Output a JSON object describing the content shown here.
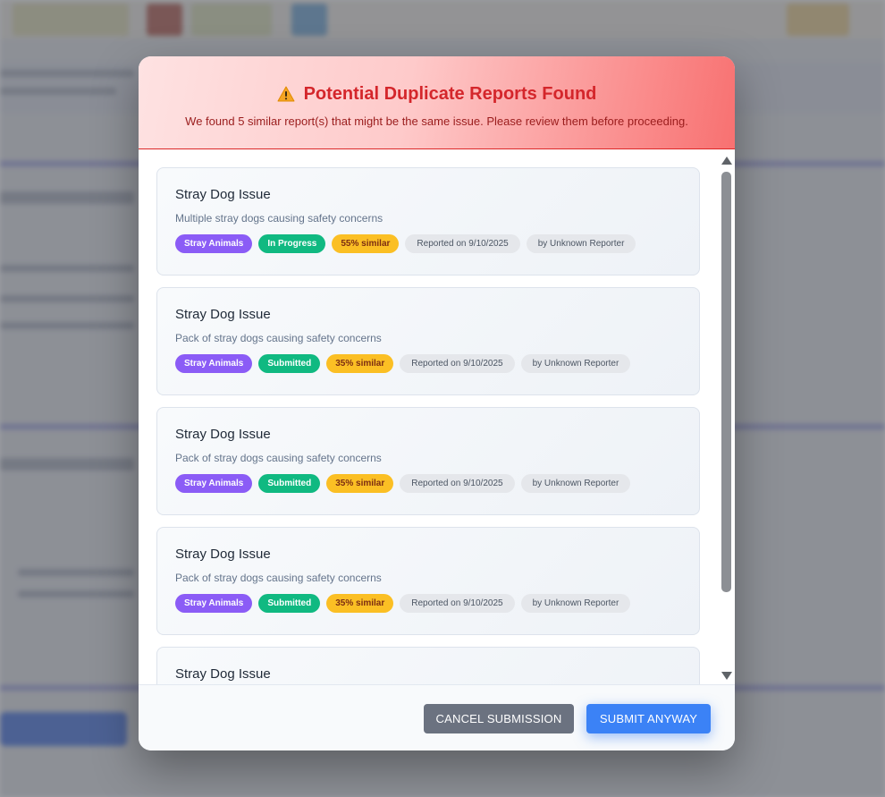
{
  "colors": {
    "title_red": "#d4262b",
    "tag_category": "#8b5cf6",
    "tag_status": "#10b981",
    "tag_similar": "#fbbf24",
    "cancel_button": "#6b7280",
    "submit_button": "#3b82f6"
  },
  "modal": {
    "icon": "warning-icon",
    "title": "Potential Duplicate Reports Found",
    "subtitle": "We found 5 similar report(s) that might be the same issue. Please review them before proceeding."
  },
  "reports": [
    {
      "title": "Stray Dog Issue",
      "description": "Multiple stray dogs causing safety concerns",
      "category": "Stray Animals",
      "status": "In Progress",
      "similarity": "55% similar",
      "reported": "Reported on 9/10/2025",
      "reporter": "by Unknown Reporter"
    },
    {
      "title": "Stray Dog Issue",
      "description": "Pack of stray dogs causing safety concerns",
      "category": "Stray Animals",
      "status": "Submitted",
      "similarity": "35% similar",
      "reported": "Reported on 9/10/2025",
      "reporter": "by Unknown Reporter"
    },
    {
      "title": "Stray Dog Issue",
      "description": "Pack of stray dogs causing safety concerns",
      "category": "Stray Animals",
      "status": "Submitted",
      "similarity": "35% similar",
      "reported": "Reported on 9/10/2025",
      "reporter": "by Unknown Reporter"
    },
    {
      "title": "Stray Dog Issue",
      "description": "Pack of stray dogs causing safety concerns",
      "category": "Stray Animals",
      "status": "Submitted",
      "similarity": "35% similar",
      "reported": "Reported on 9/10/2025",
      "reporter": "by Unknown Reporter"
    },
    {
      "title": "Stray Dog Issue"
    }
  ],
  "footer": {
    "cancel_label": "CANCEL SUBMISSION",
    "submit_label": "SUBMIT ANYWAY"
  }
}
